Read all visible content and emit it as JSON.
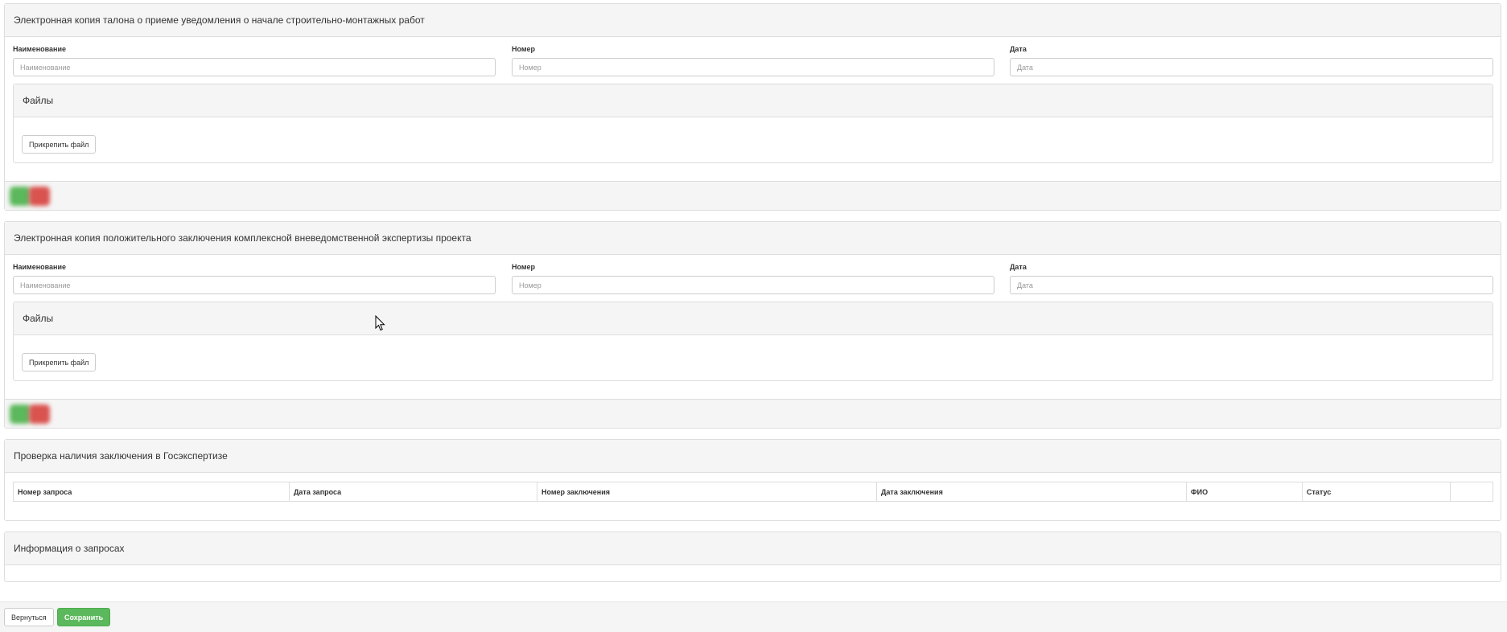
{
  "section1": {
    "title": "Электронная копия талона о приеме уведомления о начале строительно-монтажных работ",
    "name_label": "Наименование",
    "name_placeholder": "Наименование",
    "number_label": "Номер",
    "number_placeholder": "Номер",
    "date_label": "Дата",
    "date_placeholder": "Дата",
    "files_title": "Файлы",
    "attach_label": "Прикрепить файл"
  },
  "section2": {
    "title": "Электронная копия положительного заключения комплексной вневедомственной экспертизы проекта",
    "name_label": "Наименование",
    "name_placeholder": "Наименование",
    "number_label": "Номер",
    "number_placeholder": "Номер",
    "date_label": "Дата",
    "date_placeholder": "Дата",
    "files_title": "Файлы",
    "attach_label": "Прикрепить файл"
  },
  "check": {
    "title": "Проверка наличия заключения в Госэкспертизе",
    "columns": [
      "Номер запроса",
      "Дата запроса",
      "Номер заключения",
      "Дата заключения",
      "ФИО",
      "Статус",
      ""
    ]
  },
  "requests": {
    "title": "Информация о запросах"
  },
  "actions": {
    "back_label": "Вернуться",
    "save_label": "Сохранить"
  },
  "colors": {
    "success": "#5cb85c",
    "danger": "#d9534f",
    "panel_heading": "#f5f5f5",
    "border": "#dddddd"
  }
}
